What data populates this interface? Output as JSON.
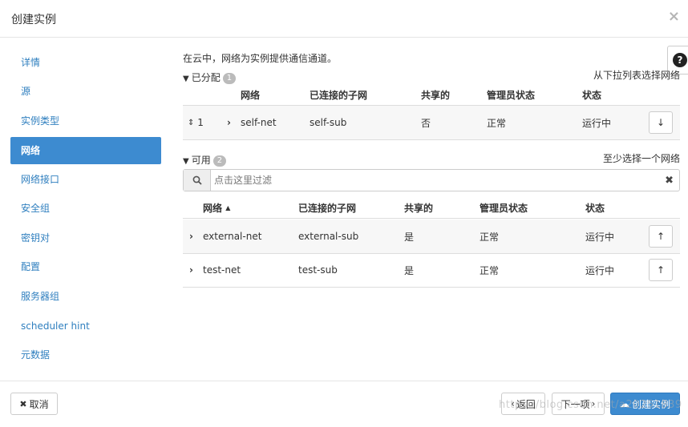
{
  "dialog": {
    "title": "创建实例"
  },
  "sidebar": {
    "items": [
      {
        "label": "详情"
      },
      {
        "label": "源"
      },
      {
        "label": "实例类型"
      },
      {
        "label": "网络"
      },
      {
        "label": "网络接口"
      },
      {
        "label": "安全组"
      },
      {
        "label": "密钥对"
      },
      {
        "label": "配置"
      },
      {
        "label": "服务器组"
      },
      {
        "label": "scheduler hint"
      },
      {
        "label": "元数据"
      }
    ],
    "active_index": 3
  },
  "intro": "在云中，网络为实例提供通信通道。",
  "help_label": "?",
  "allocated": {
    "title": "已分配",
    "count": "1",
    "note": "从下拉列表选择网络",
    "headers": {
      "network": "网络",
      "subnets": "已连接的子网",
      "shared": "共享的",
      "admin_state": "管理员状态",
      "status": "状态"
    },
    "rows": [
      {
        "order": "1",
        "network": "self-net",
        "subnets": "self-sub",
        "shared": "否",
        "admin_state": "正常",
        "status": "运行中"
      }
    ]
  },
  "available": {
    "title": "可用",
    "count": "2",
    "note": "至少选择一个网络",
    "filter_placeholder": "点击这里过滤",
    "headers": {
      "network": "网络",
      "subnets": "已连接的子网",
      "shared": "共享的",
      "admin_state": "管理员状态",
      "status": "状态"
    },
    "rows": [
      {
        "network": "external-net",
        "subnets": "external-sub",
        "shared": "是",
        "admin_state": "正常",
        "status": "运行中"
      },
      {
        "network": "test-net",
        "subnets": "test-sub",
        "shared": "是",
        "admin_state": "正常",
        "status": "运行中"
      }
    ]
  },
  "footer": {
    "cancel": "取消",
    "back": "返回",
    "next": "下一项",
    "create": "创建实例"
  },
  "watermark": "https://blog.csdn.net/a20251839",
  "colors": {
    "accent": "#3d8bd0",
    "link": "#2f7fbf"
  }
}
